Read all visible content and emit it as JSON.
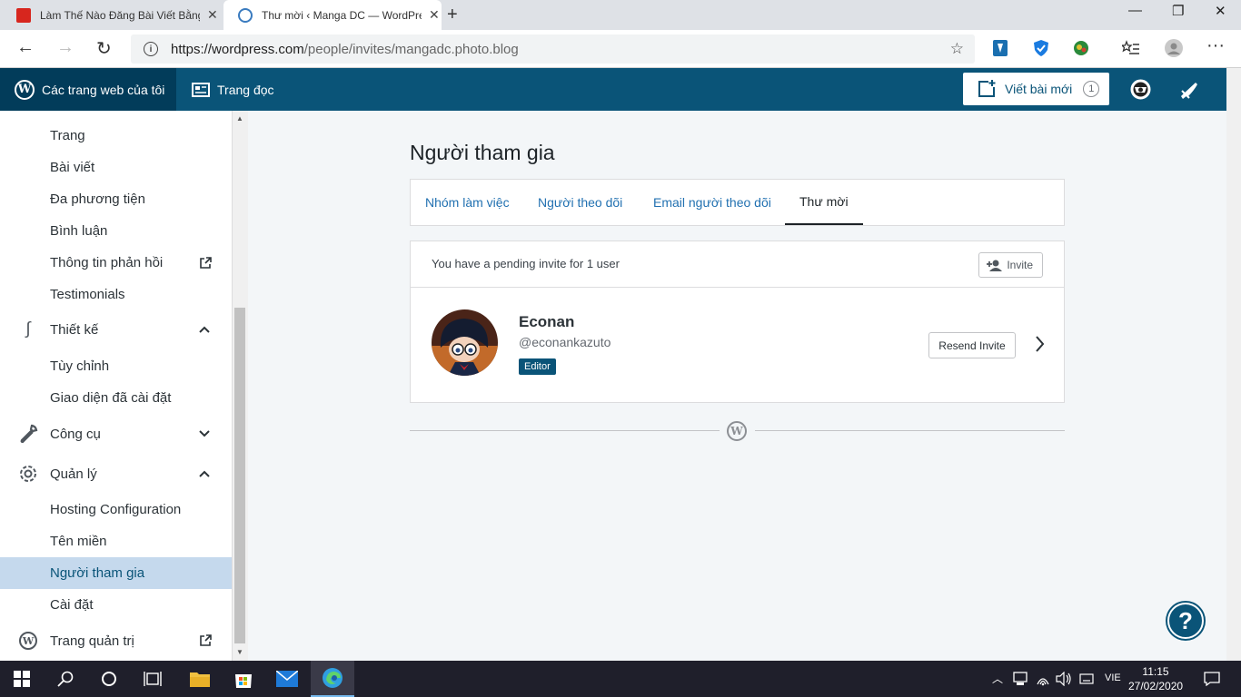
{
  "browser": {
    "tabs": [
      {
        "title": "Làm Thế Nào Đăng Bài Viết Bằng",
        "icon": "red-site-icon"
      },
      {
        "title": "Thư mời ‹ Manga DC — WordPress",
        "icon": "wordpress-icon"
      }
    ],
    "url_host": "https://wordpress.com",
    "url_path": "/people/invites/mangadc.photo.blog"
  },
  "masterbar": {
    "my_sites": "Các trang web của tôi",
    "reader": "Trang đọc",
    "write": "Viết bài mới",
    "write_count": "1"
  },
  "sidebar": {
    "items": [
      {
        "label": "Trang"
      },
      {
        "label": "Bài viết"
      },
      {
        "label": "Đa phương tiện"
      },
      {
        "label": "Bình luận"
      },
      {
        "label": "Thông tin phản hồi"
      },
      {
        "label": "Testimonials"
      },
      {
        "label": "Thiết kế"
      },
      {
        "label": "Tùy chỉnh"
      },
      {
        "label": "Giao diện đã cài đặt"
      },
      {
        "label": "Công cụ"
      },
      {
        "label": "Quản lý"
      },
      {
        "label": "Hosting Configuration"
      },
      {
        "label": "Tên miền"
      },
      {
        "label": "Người tham gia"
      },
      {
        "label": "Cài đặt"
      },
      {
        "label": "Trang quản trị"
      }
    ]
  },
  "main": {
    "title": "Người tham gia",
    "tabs": [
      {
        "label": "Nhóm làm việc"
      },
      {
        "label": "Người theo dõi"
      },
      {
        "label": "Email người theo dõi"
      },
      {
        "label": "Thư mời"
      }
    ],
    "pending_text": "You have a pending invite for 1 user",
    "invite_button": "Invite",
    "invitee": {
      "name": "Econan",
      "handle": "@econankazuto",
      "role": "Editor"
    },
    "resend_button": "Resend Invite"
  },
  "taskbar": {
    "language": "VIE",
    "time": "11:15",
    "date": "27/02/2020"
  },
  "colors": {
    "masterbar": "#0a5478",
    "masterbar_dark": "#023c5a",
    "sidebar_active": "#c5d9ed",
    "link": "#2271b1"
  }
}
